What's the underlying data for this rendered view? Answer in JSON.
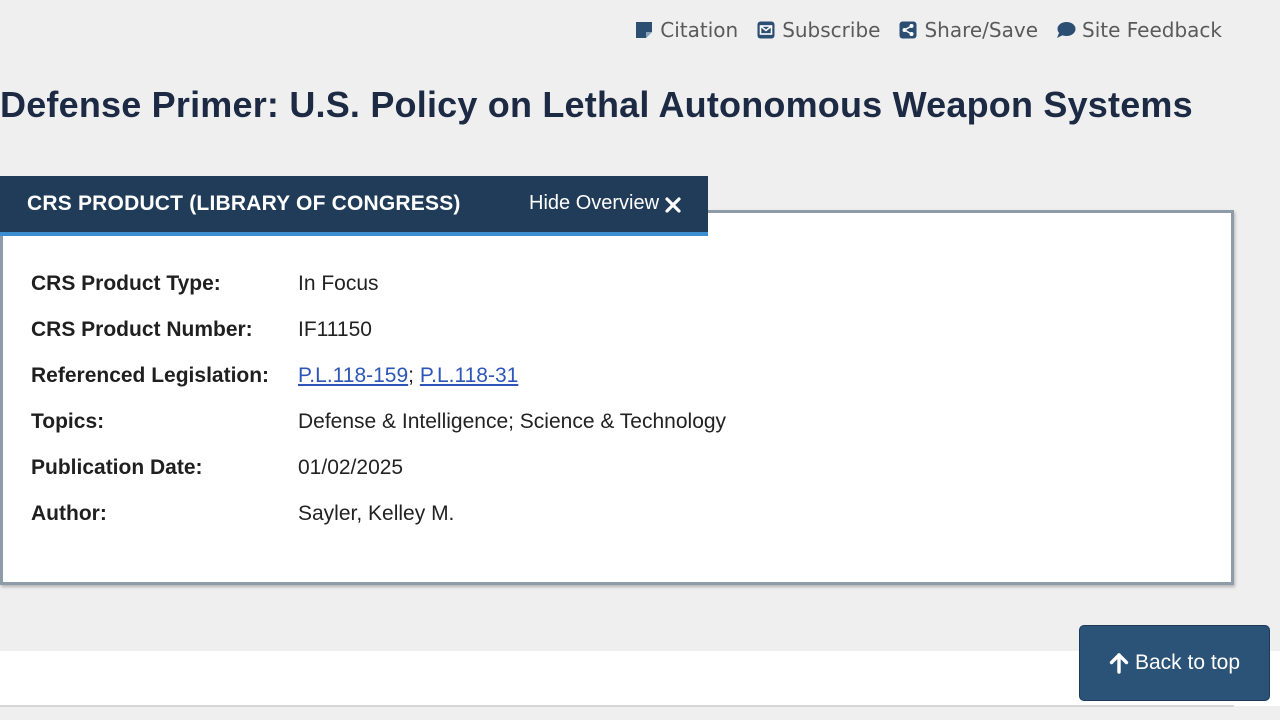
{
  "util_nav": [
    {
      "label": "Citation",
      "icon": "citation-icon"
    },
    {
      "label": "Subscribe",
      "icon": "envelope-icon"
    },
    {
      "label": "Share/Save",
      "icon": "share-icon"
    },
    {
      "label": "Site Feedback",
      "icon": "speech-bubble-icon"
    }
  ],
  "title": "Defense Primer: U.S. Policy on Lethal Autonomous Weapon Systems",
  "overview": {
    "tab_title": "CRS PRODUCT (LIBRARY OF CONGRESS)",
    "hide_label": "Hide Overview",
    "rows": [
      {
        "label": "CRS Product Type:",
        "value": "In Focus"
      },
      {
        "label": "CRS Product Number:",
        "value": "IF11150"
      },
      {
        "label": "Referenced Legislation:",
        "links": [
          "P.L.118-159",
          "P.L.118-31"
        ],
        "separator": "; "
      },
      {
        "label": "Topics:",
        "value": "Defense & Intelligence; Science & Technology"
      },
      {
        "label": "Publication Date:",
        "value": "01/02/2025"
      },
      {
        "label": "Author:",
        "value": "Sayler, Kelley M."
      }
    ]
  },
  "back_to_top": "Back to top",
  "colors": {
    "header_navy": "#213c59",
    "accent_blue": "#3b8ed0",
    "title_text": "#1d2a44",
    "link_blue": "#2d56b8",
    "button_bg": "#2a5377"
  }
}
